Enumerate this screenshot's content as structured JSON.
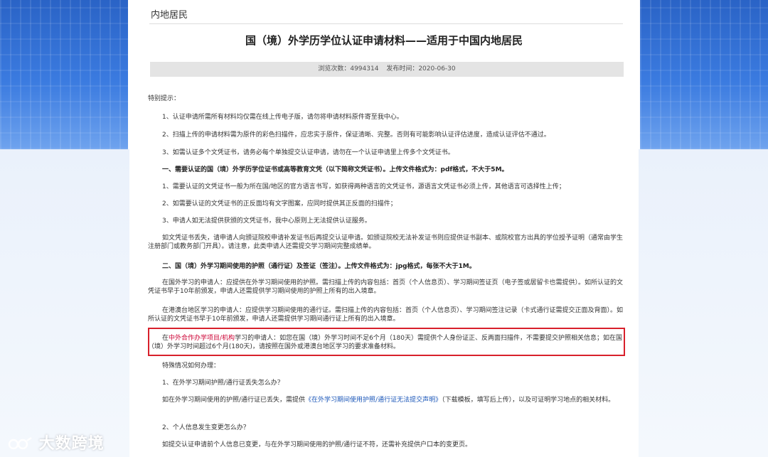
{
  "breadcrumb": "内地居民",
  "title": "国（境）外学历学位认证申请材料——适用于中国内地居民",
  "meta": {
    "views": "浏览次数：4994314",
    "published": "发布时间：2020-06-30"
  },
  "paragraphs": {
    "special_tip": "特别提示：",
    "tip1": "1、认证申请所需所有材料均仅需在线上传电子版，请勿将申请材料原件寄至我中心。",
    "tip2": "2、扫描上传的申请材料需为原件的彩色扫描件，应忠实于原件，保证清晰、完整。否则有可能影响认证评估进度，造成认证评估不通过。",
    "tip3": "3、如需认证多个文凭证书，请务必每个单独提交认证申请，请勿在一个认证申请里上传多个文凭证书。",
    "section1": "一、需要认证的国（境）外学历学位证书或高等教育文凭（以下简称文凭证书）。上传文件格式为：pdf格式，不大于5M。",
    "s1_1": "1、需要认证的文凭证书一般为所在国/地区的官方语言书写，如获得两种语言的文凭证书，源语言文凭证书必须上传，其他语言可选择性上传；",
    "s1_2": "2、如需要认证的文凭证书的正反面均有文字图案，应同时提供其正反面的扫描件；",
    "s1_3": "3、申请人如无法提供获颁的文凭证书，我中心原则上无法提供认证服务。",
    "s1_note": "如文凭证书丢失，请申请人向颁证院校申请补发证书后再提交认证申请。如颁证院校无法补发证书则应提供证书副本、或院校官方出具的学位授予证明（通常由学生注册部门或教务部门开具）。请注意，此类申请人还需提交学习期间完整成绩单。",
    "section2": "二、国（境）外学习期间使用的护照（通行证）及签证（签注）。上传文件格式为：jpg格式，每张不大于1M。",
    "s2_abroad": "在国外学习的申请人：应提供在外学习期间使用的护照。需扫描上传的内容包括：首页（个人信息页）、学习期间签证页（电子签或居留卡也需提供）。如所认证的文凭证书早于10年前颁发，申请人还需提供学习期间使用的护照上所有的出入境章。",
    "s2_hkmt": "在港澳台地区学习的申请人：应提供学习期间使用的通行证。需扫描上传的内容包括：首页（个人信息页）、学习期间签注记录（卡式通行证需提交正面及背面）。如所认证的文凭证书早于10年前颁发，申请人还需提供学习期间通行证上所有的出入境章。",
    "s2_coop_prefix": "在",
    "s2_coop_red": "中外合作办学项目/机构",
    "s2_coop_rest": "学习的申请人：如您在国（境）外学习时间不足6个月（180天）需提供个人身份证正、反两面扫描件，不需要提交护照相关信息；如在国（境）外学习时间超过6个月(180天)，请按照在国外或港澳台地区学习的要求准备材料。",
    "special_cases": "特殊情况如何办理：",
    "q1": "1、在外学习期间护照/通行证丢失怎么办？",
    "a1_prefix": "如在外学习期间使用的护照/通行证已丢失，需提供",
    "a1_link": "《在外学习期间使用护照/通行证无法提交声明》",
    "a1_rest": "（下载模板，填写后上传），以及可证明学习地点的相关材料。",
    "q2": "2、个人信息发生变更怎么办？",
    "a2": "如提交认证申请前个人信息已变更，与在外学习期间使用的护照/通行证不符，还需补充提供户口本的变更页。"
  },
  "watermark": "大数跨境",
  "colors": {
    "highlight_border": "#d8202b",
    "red_text": "#cc0033",
    "link": "#1a56b8",
    "meta_bg": "#e4e4e4",
    "side_blue": "#2a63c6"
  }
}
